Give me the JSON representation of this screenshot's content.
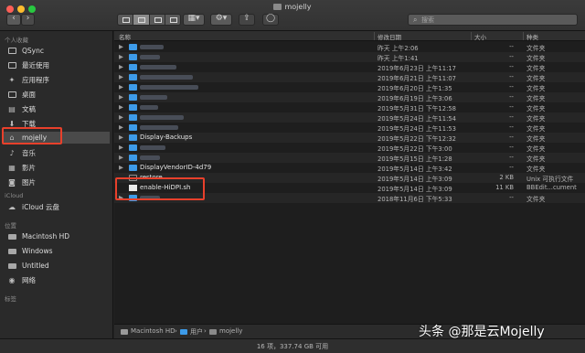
{
  "window": {
    "title": "mojelly"
  },
  "toolbar": {
    "back_glyph": "‹",
    "forward_glyph": "›",
    "search_placeholder": "搜索"
  },
  "sidebar": {
    "favorites_header": "个人收藏",
    "favorites": [
      {
        "label": "QSync",
        "icon": "folder-icon"
      },
      {
        "label": "最近使用",
        "icon": "recents-icon"
      },
      {
        "label": "应用程序",
        "icon": "applications-icon"
      },
      {
        "label": "桌面",
        "icon": "desktop-icon"
      },
      {
        "label": "文稿",
        "icon": "documents-icon"
      },
      {
        "label": "下载",
        "icon": "downloads-icon"
      },
      {
        "label": "mojelly",
        "icon": "home-icon",
        "selected": true
      },
      {
        "label": "音乐",
        "icon": "music-icon"
      },
      {
        "label": "影片",
        "icon": "movies-icon"
      },
      {
        "label": "图片",
        "icon": "pictures-icon"
      }
    ],
    "icloud_header": "iCloud",
    "icloud": [
      {
        "label": "iCloud 云盘",
        "icon": "cloud-icon"
      }
    ],
    "locations_header": "位置",
    "locations": [
      {
        "label": "Macintosh HD",
        "icon": "disk-icon"
      },
      {
        "label": "Windows",
        "icon": "disk-icon"
      },
      {
        "label": "Untitled",
        "icon": "disk-icon"
      },
      {
        "label": "网络",
        "icon": "network-icon"
      }
    ],
    "tags_header": "标签"
  },
  "columns": {
    "name": "名称",
    "date": "修改日期",
    "size": "大小",
    "kind": "种类"
  },
  "rows": [
    {
      "name": "",
      "date": "昨天 上午2:06",
      "size": "--",
      "kind": "文件夹",
      "type": "folder"
    },
    {
      "name": "",
      "date": "昨天 上午1:41",
      "size": "--",
      "kind": "文件夹",
      "type": "folder"
    },
    {
      "name": "",
      "date": "2019年6月23日 上午11:17",
      "size": "--",
      "kind": "文件夹",
      "type": "folder"
    },
    {
      "name": "",
      "date": "2019年6月21日 上午11:07",
      "size": "--",
      "kind": "文件夹",
      "type": "folder"
    },
    {
      "name": "",
      "date": "2019年6月20日 上午1:35",
      "size": "--",
      "kind": "文件夹",
      "type": "folder"
    },
    {
      "name": "",
      "date": "2019年6月19日 上午3:06",
      "size": "--",
      "kind": "文件夹",
      "type": "folder"
    },
    {
      "name": "",
      "date": "2019年5月31日 下午12:58",
      "size": "--",
      "kind": "文件夹",
      "type": "folder"
    },
    {
      "name": "",
      "date": "2019年5月24日 上午11:54",
      "size": "--",
      "kind": "文件夹",
      "type": "folder"
    },
    {
      "name": "",
      "date": "2019年5月24日 上午11:53",
      "size": "--",
      "kind": "文件夹",
      "type": "folder"
    },
    {
      "name": "Display-Backups",
      "date": "2019年5月22日 下午12:32",
      "size": "--",
      "kind": "文件夹",
      "type": "folder"
    },
    {
      "name": "",
      "date": "2019年5月22日 下午3:00",
      "size": "--",
      "kind": "文件夹",
      "type": "folder"
    },
    {
      "name": "",
      "date": "2019年5月15日 上午1:28",
      "size": "--",
      "kind": "文件夹",
      "type": "folder"
    },
    {
      "name": "DisplayVendorID-4d79",
      "date": "2019年5月14日 上午3:42",
      "size": "--",
      "kind": "文件夹",
      "type": "folder"
    },
    {
      "name": "restore",
      "date": "2019年5月14日 上午3:09",
      "size": "2 KB",
      "kind": "Unix 可执行文件",
      "type": "exec"
    },
    {
      "name": "enable-HiDPI.sh",
      "date": "2019年5月14日 上午3:09",
      "size": "11 KB",
      "kind": "BBEdit...cument",
      "type": "doc"
    },
    {
      "name": "",
      "date": "2018年11月6日 下午5:33",
      "size": "--",
      "kind": "文件夹",
      "type": "folder"
    }
  ],
  "pathbar": {
    "items": [
      "Macintosh HD",
      "用户",
      "mojelly"
    ]
  },
  "status": {
    "text": "16 项，337.74 GB 可用"
  },
  "watermark": {
    "text": "头条 @那是云Mojelly"
  },
  "colors": {
    "highlight": "#e8402b",
    "folder": "#3d9be9",
    "selection": "#4a4a4a"
  }
}
